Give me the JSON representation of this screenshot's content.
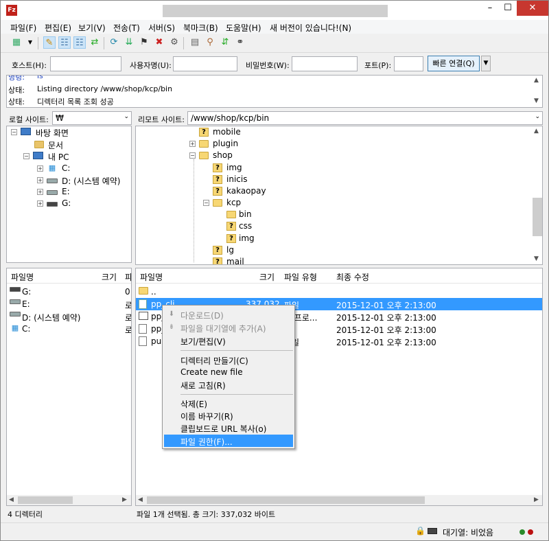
{
  "window": {
    "minimize": "–",
    "maximize": "☐",
    "close": "✕"
  },
  "menu": [
    "파일(F)",
    "편집(E)",
    "보기(V)",
    "전송(T)",
    "서버(S)",
    "북마크(B)",
    "도움말(H)",
    "새 버전이 있습니다!(N)"
  ],
  "quickconnect": {
    "host_label": "호스트(H):",
    "user_label": "사용자명(U):",
    "pass_label": "비밀번호(W):",
    "port_label": "포트(P):",
    "connect_button": "빠른 연결(Q)",
    "dropdown": "▼"
  },
  "log": [
    {
      "key": "명령:",
      "msg": "ls"
    },
    {
      "key": "상태:",
      "msg": "Listing directory /www/shop/kcp/bin"
    },
    {
      "key": "상태:",
      "msg": "디렉터리 목록 조회 성공"
    }
  ],
  "local": {
    "site_label": "로컬 사이트:",
    "site_path": "₩",
    "tree": [
      {
        "label": "바탕 화면",
        "icon": "desktop-icon"
      },
      {
        "label": "문서",
        "icon": "document-folder-icon"
      },
      {
        "label": "내 PC",
        "icon": "computer-icon"
      },
      {
        "label": "C:",
        "icon": "windows-drive-icon"
      },
      {
        "label": "D: (시스템 예약)",
        "icon": "drive-icon"
      },
      {
        "label": "E:",
        "icon": "drive-icon"
      },
      {
        "label": "G:",
        "icon": "drive-icon"
      }
    ],
    "columns": [
      "파일명",
      "크기",
      "파"
    ],
    "files": [
      {
        "name": "G:",
        "type": "0"
      },
      {
        "name": "E:",
        "type": "로"
      },
      {
        "name": "D: (시스템 예약)",
        "type": "로"
      },
      {
        "name": "C:",
        "type": "로"
      }
    ],
    "status": "4 디렉터리"
  },
  "remote": {
    "site_label": "리모트 사이트:",
    "site_path": "/www/shop/kcp/bin",
    "tree": [
      {
        "label": "mobile"
      },
      {
        "label": "plugin"
      },
      {
        "label": "shop"
      },
      {
        "label": "img"
      },
      {
        "label": "inicis"
      },
      {
        "label": "kakaopay"
      },
      {
        "label": "kcp"
      },
      {
        "label": "bin"
      },
      {
        "label": "css"
      },
      {
        "label": "img"
      },
      {
        "label": "lg"
      },
      {
        "label": "mail"
      }
    ],
    "columns": [
      "파일명",
      "크기",
      "파일 유형",
      "최종 수정"
    ],
    "files": [
      {
        "name": "..",
        "size": "",
        "type": "",
        "modified": ""
      },
      {
        "name": "pp_cli",
        "size": "337,032",
        "type": "파일",
        "modified": "2015-12-01 오후 2:13:00"
      },
      {
        "name": "pp_",
        "size": "",
        "type": "응 프로...",
        "modified": "2015-12-01 오후 2:13:00"
      },
      {
        "name": "pp_",
        "size": "",
        "type": "일",
        "modified": "2015-12-01 오후 2:13:00"
      },
      {
        "name": "pub",
        "size": "",
        "type": "파일",
        "modified": "2015-12-01 오후 2:13:00"
      }
    ],
    "status": "파일 1개 선택됨. 총 크기: 337,032 바이트"
  },
  "context_menu": {
    "download": "다운로드(D)",
    "add_to_queue": "파일을 대기열에 추가(A)",
    "view_edit": "보기/편집(V)",
    "create_dir": "디렉터리 만들기(C)",
    "create_file": "Create new file",
    "refresh": "새로 고침(R)",
    "delete": "삭제(E)",
    "rename": "이름 바꾸기(R)",
    "copy_url": "클립보드로 URL 복사(o)",
    "permissions": "파일 권한(F)..."
  },
  "statusbar": {
    "queue": "대기열: 비었음"
  },
  "colors": {
    "selection": "#3399ff",
    "close_button": "#c7372f",
    "folder": "#f7d774"
  }
}
